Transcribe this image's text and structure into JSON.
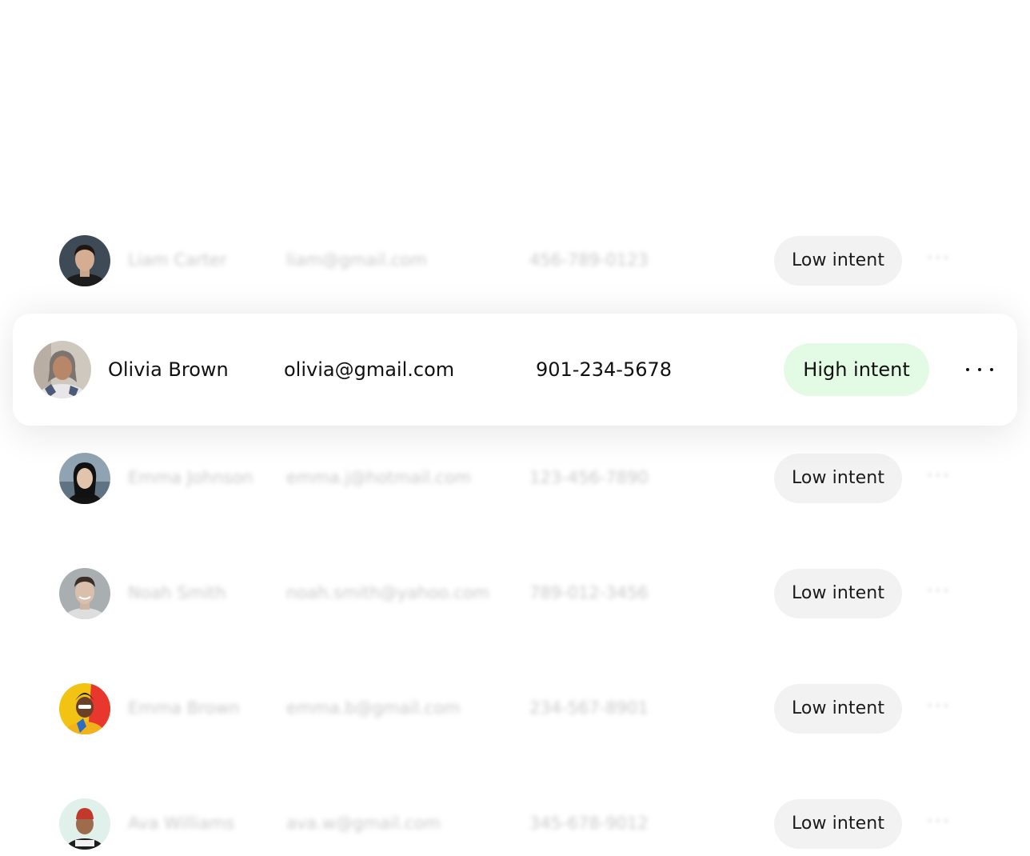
{
  "focused_contact": {
    "name": "Olivia Brown",
    "email": "olivia@gmail.com",
    "phone": "901-234-5678",
    "intent": "High intent",
    "intent_color": "#e3fbe5"
  },
  "contacts": [
    {
      "name": "Liam Carter",
      "email": "liam@gmail.com",
      "phone": "456-789-0123",
      "intent": "Low intent"
    },
    {
      "name": "Emma Johnson",
      "email": "emma.j@hotmail.com",
      "phone": "123-456-7890",
      "intent": "Low intent"
    },
    {
      "name": "Noah Smith",
      "email": "noah.smith@yahoo.com",
      "phone": "789-012-3456",
      "intent": "Low intent"
    },
    {
      "name": "Emma Brown",
      "email": "emma.b@gmail.com",
      "phone": "234-567-8901",
      "intent": "Low intent"
    },
    {
      "name": "Ava Williams",
      "email": "ava.w@gmail.com",
      "phone": "345-678-9012",
      "intent": "Low intent"
    }
  ],
  "more_label": "···",
  "icons": {
    "more": "more-options-icon"
  },
  "colors": {
    "low_intent_bg": "#f2f2f2",
    "high_intent_bg": "#e3fbe5"
  }
}
